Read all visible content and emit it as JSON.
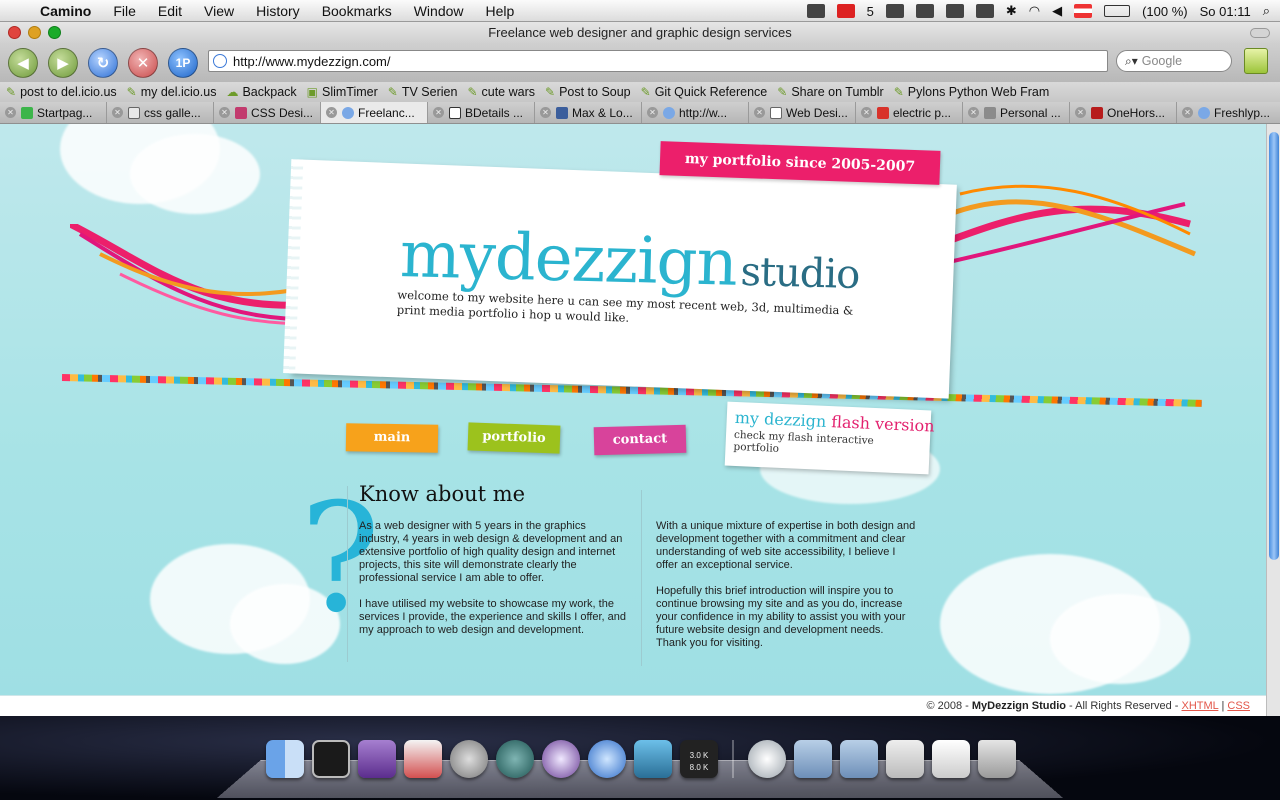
{
  "menubar": {
    "app_name": "Camino",
    "items": [
      "File",
      "Edit",
      "View",
      "History",
      "Bookmarks",
      "Window",
      "Help"
    ],
    "mail_count": "5",
    "battery": "(100 %)",
    "clock": "So 01:11"
  },
  "window": {
    "title": "Freelance web designer and graphic design services"
  },
  "toolbar": {
    "url": "http://www.mydezzign.com/",
    "search_placeholder": "Google",
    "onepassword_label": "1P"
  },
  "bookmarks": [
    "post to del.icio.us",
    "my del.icio.us",
    "Backpack",
    "SlimTimer",
    "TV Serien",
    "cute wars",
    "Post to Soup",
    "Git Quick Reference",
    "Share on Tumblr",
    "Pylons Python Web Fram"
  ],
  "tabs": [
    {
      "label": "Startpag...",
      "active": false
    },
    {
      "label": "css galle...",
      "active": false
    },
    {
      "label": "CSS Desi...",
      "active": false
    },
    {
      "label": "Freelanc...",
      "active": true
    },
    {
      "label": "BDetails ...",
      "active": false
    },
    {
      "label": "Max & Lo...",
      "active": false
    },
    {
      "label": "http://w...",
      "active": false
    },
    {
      "label": "Web Desi...",
      "active": false
    },
    {
      "label": "electric p...",
      "active": false
    },
    {
      "label": "Personal ...",
      "active": false
    },
    {
      "label": "OneHors...",
      "active": false
    },
    {
      "label": "Freshlyp...",
      "active": false
    }
  ],
  "site": {
    "since_tag": "my portfolio since 2005-2007",
    "logo_main": "mydezzign",
    "logo_sub": "studio",
    "welcome": "welcome to my website here u can see my most recent web, 3d, multimedia & print media portfolio i hop u would like.",
    "nav": {
      "main": "main",
      "portfolio": "portfolio",
      "contact": "contact"
    },
    "flash": {
      "title_a": "my dezzign",
      "title_b": "flash version",
      "subtitle": "check my flash interactive portfolio"
    },
    "about": {
      "title": "Know about me",
      "left_p1": "As a web designer with 5 years in the graphics industry, 4 years in web design & development and an extensive portfolio of high quality design and internet projects, this site will demonstrate clearly the professional service I am able to offer.",
      "left_p2": "I have utilised my website to showcase my work, the services I provide, the experience and skills I offer, and my approach to web design and development.",
      "right_p1": "With a unique mixture of expertise in both design and development together with a commitment and clear understanding of web site accessibility, I believe I offer an exceptional service.",
      "right_p2": "Hopefully this brief introduction will inspire you to continue browsing my site and as you do, increase your confidence in my ability to assist you with your future website design and development needs. Thank you for visiting."
    },
    "footer": {
      "prefix": "© 2008 - ",
      "brand": "MyDezzign Studio",
      "rights": " - All Rights Reserved - ",
      "xhtml": "XHTML",
      "sep": " | ",
      "css": "CSS"
    }
  },
  "dock": {
    "net_up": "3.0 K",
    "net_down": "8.0 K"
  },
  "colors": {
    "accent_cyan": "#2bb4cf",
    "accent_pink": "#ec1f6b",
    "nav_orange": "#f7a21b",
    "nav_green": "#9cc21d",
    "nav_magenta": "#d8439b"
  }
}
